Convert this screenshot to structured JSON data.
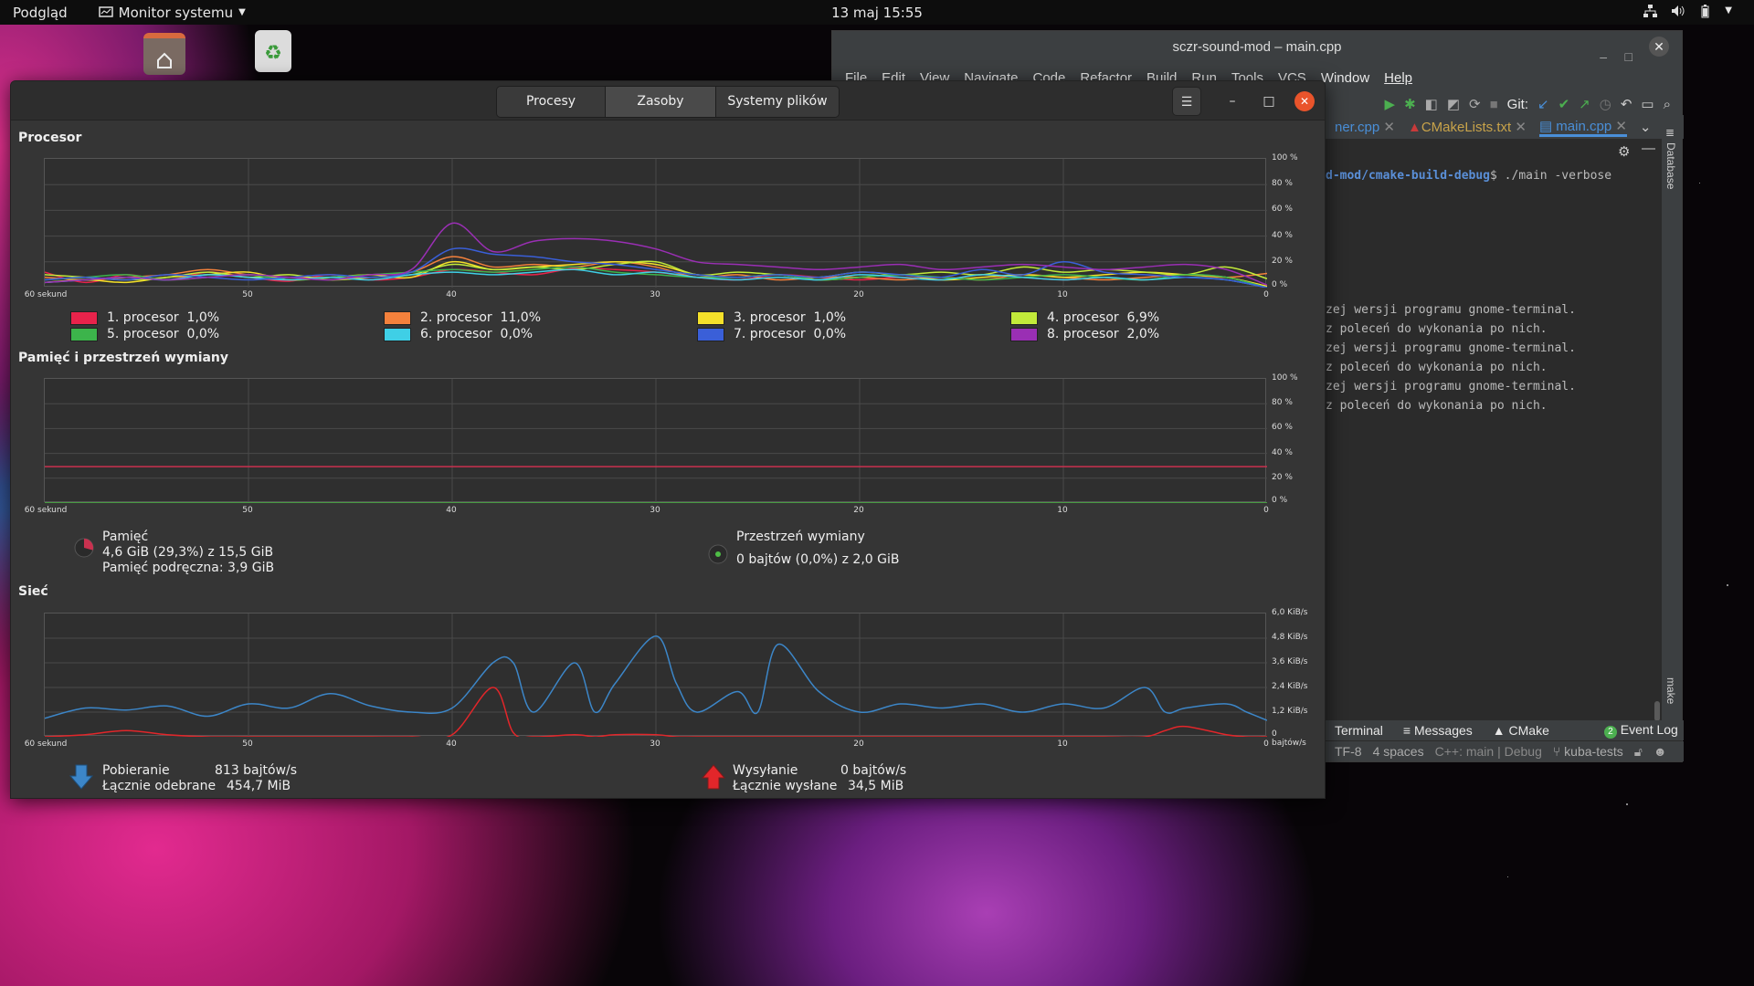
{
  "topbar": {
    "activities": "Podgląd",
    "app_menu": "Monitor systemu",
    "clock": "13 maj  15:55"
  },
  "ide": {
    "title": "sczr-sound-mod – main.cpp",
    "menu": [
      "File",
      "Edit",
      "View",
      "Navigate",
      "Code",
      "Refactor",
      "Build",
      "Run",
      "Tools",
      "VCS",
      "Window",
      "Help"
    ],
    "git_label": "Git:",
    "tabs": [
      "ner.cpp",
      "CMakeLists.txt",
      "main.cpp"
    ],
    "side_label": "Database",
    "side_label2": "make",
    "prompt_path": "d-mod/cmake-build-debug",
    "prompt_cmd": "$ ./main -verbose",
    "terminal_lines": [
      "zej wersji programu gnome-terminal.",
      "z poleceń do wykonania po nich.",
      "zej wersji programu gnome-terminal.",
      "z poleceń do wykonania po nich.",
      "zej wersji programu gnome-terminal.",
      "z poleceń do wykonania po nich."
    ],
    "bottom_tabs": [
      "Terminal",
      "Messages",
      "CMake",
      "Event Log"
    ],
    "event_count": "2",
    "status": [
      "TF-8",
      "4 spaces",
      "C++: main | Debug",
      "kuba-tests"
    ]
  },
  "monitor": {
    "tabs": [
      "Procesy",
      "Zasoby",
      "Systemy plików"
    ],
    "active_tab": "Zasoby",
    "cpu": {
      "title": "Procesor",
      "y_ticks": [
        "100 %",
        "80 %",
        "60 %",
        "40 %",
        "20 %",
        "0 %"
      ],
      "x_ticks": [
        "60 sekund",
        "50",
        "40",
        "30",
        "20",
        "10",
        "0"
      ],
      "legend": [
        {
          "label": "1. procesor",
          "value": "1,0%",
          "color": "#e8234b"
        },
        {
          "label": "2. procesor",
          "value": "11,0%",
          "color": "#f4813c"
        },
        {
          "label": "3. procesor",
          "value": "1,0%",
          "color": "#f4e02a"
        },
        {
          "label": "4. procesor",
          "value": "6,9%",
          "color": "#c2ea3a"
        },
        {
          "label": "5. procesor",
          "value": "0,0%",
          "color": "#3cb44b"
        },
        {
          "label": "6. procesor",
          "value": "0,0%",
          "color": "#3fcfe6"
        },
        {
          "label": "7. procesor",
          "value": "0,0%",
          "color": "#3a5fd8"
        },
        {
          "label": "8. procesor",
          "value": "2,0%",
          "color": "#9a2fb4"
        }
      ]
    },
    "memory": {
      "title": "Pamięć i przestrzeń wymiany",
      "y_ticks": [
        "100 %",
        "80 %",
        "60 %",
        "40 %",
        "20 %",
        "0 %"
      ],
      "x_ticks": [
        "60 sekund",
        "50",
        "40",
        "30",
        "20",
        "10",
        "0"
      ],
      "mem_label": "Pamięć",
      "mem_value": "4,6 GiB (29,3%) z 15,5 GiB",
      "mem_cache": "Pamięć podręczna: 3,9 GiB",
      "mem_color": "#c9314f",
      "mem_percent": 29.3,
      "swap_label": "Przestrzeń wymiany",
      "swap_value": "0 bajtów (0,0%) z 2,0 GiB",
      "swap_color": "#4ebd46",
      "swap_percent": 0.0
    },
    "network": {
      "title": "Sieć",
      "y_ticks": [
        "6,0 KiB/s",
        "4,8 KiB/s",
        "3,6 KiB/s",
        "2,4 KiB/s",
        "1,2 KiB/s",
        "0 bajtów/s"
      ],
      "x_ticks": [
        "60 sekund",
        "50",
        "40",
        "30",
        "20",
        "10",
        "0"
      ],
      "down_label": "Pobieranie",
      "down_rate": "813 bajtów/s",
      "down_total_label": "Łącznie odebrane",
      "down_total": "454,7 MiB",
      "down_color": "#3c86c8",
      "up_label": "Wysyłanie",
      "up_rate": "0 bajtów/s",
      "up_total_label": "Łącznie wysłane",
      "up_total": "34,5 MiB",
      "up_color": "#e2262a"
    }
  },
  "chart_data": [
    {
      "type": "line",
      "title": "Procesor",
      "x": [
        60,
        58,
        56,
        54,
        52,
        50,
        48,
        46,
        44,
        42,
        40,
        38,
        36,
        34,
        32,
        30,
        28,
        26,
        24,
        22,
        20,
        18,
        16,
        14,
        12,
        10,
        8,
        6,
        4,
        2,
        0
      ],
      "ylim": [
        0,
        100
      ],
      "series": [
        {
          "name": "1. procesor",
          "values": [
            12,
            4,
            10,
            6,
            12,
            8,
            5,
            10,
            6,
            8,
            14,
            12,
            10,
            15,
            14,
            12,
            8,
            6,
            10,
            8,
            6,
            8,
            6,
            10,
            8,
            6,
            8,
            6,
            10,
            8,
            1
          ]
        },
        {
          "name": "2. procesor",
          "values": [
            8,
            6,
            8,
            10,
            14,
            10,
            8,
            8,
            10,
            12,
            24,
            16,
            18,
            16,
            20,
            16,
            8,
            10,
            6,
            8,
            8,
            6,
            8,
            6,
            10,
            8,
            6,
            8,
            10,
            8,
            11
          ]
        },
        {
          "name": "3. procesor",
          "values": [
            4,
            6,
            4,
            8,
            10,
            12,
            6,
            8,
            10,
            8,
            20,
            14,
            16,
            18,
            20,
            18,
            10,
            8,
            10,
            6,
            8,
            10,
            6,
            8,
            10,
            8,
            10,
            12,
            10,
            8,
            1
          ]
        },
        {
          "name": "4. procesor",
          "values": [
            10,
            8,
            6,
            8,
            12,
            8,
            10,
            6,
            8,
            10,
            18,
            14,
            16,
            14,
            18,
            20,
            10,
            12,
            10,
            8,
            12,
            10,
            12,
            10,
            16,
            12,
            14,
            12,
            10,
            16,
            6.9
          ]
        },
        {
          "name": "5. procesor",
          "values": [
            6,
            8,
            10,
            6,
            8,
            10,
            6,
            8,
            10,
            12,
            14,
            12,
            14,
            16,
            12,
            10,
            8,
            8,
            10,
            6,
            8,
            10,
            8,
            6,
            8,
            10,
            8,
            6,
            10,
            8,
            0
          ]
        },
        {
          "name": "6. procesor",
          "values": [
            4,
            6,
            8,
            6,
            10,
            8,
            6,
            8,
            6,
            10,
            12,
            10,
            12,
            14,
            10,
            12,
            8,
            6,
            8,
            6,
            10,
            8,
            6,
            10,
            8,
            6,
            8,
            6,
            8,
            6,
            0
          ]
        },
        {
          "name": "7. procesor",
          "values": [
            6,
            8,
            6,
            10,
            8,
            6,
            8,
            10,
            8,
            12,
            30,
            26,
            24,
            20,
            18,
            14,
            10,
            8,
            10,
            8,
            12,
            10,
            8,
            14,
            10,
            20,
            12,
            10,
            8,
            6,
            0
          ]
        },
        {
          "name": "8. procesor",
          "values": [
            4,
            6,
            8,
            6,
            8,
            10,
            8,
            6,
            10,
            14,
            50,
            28,
            36,
            38,
            36,
            30,
            20,
            18,
            16,
            14,
            16,
            18,
            14,
            16,
            18,
            16,
            14,
            16,
            18,
            14,
            2
          ]
        }
      ]
    },
    {
      "type": "line",
      "title": "Pamięć i przestrzeń wymiany",
      "x": [
        60,
        0
      ],
      "ylim": [
        0,
        100
      ],
      "series": [
        {
          "name": "Pamięć",
          "values": [
            29.3,
            29.3
          ]
        },
        {
          "name": "Przestrzeń wymiany",
          "values": [
            0,
            0
          ]
        }
      ]
    },
    {
      "type": "line",
      "title": "Sieć",
      "x": [
        60,
        58,
        56,
        54,
        52,
        50,
        48,
        46,
        44,
        42,
        40,
        38,
        37,
        36,
        34,
        33,
        32,
        30,
        29,
        28,
        26,
        25,
        24,
        22,
        20,
        18,
        16,
        14,
        12,
        10,
        8,
        6,
        5,
        4,
        2,
        1,
        0
      ],
      "ylim": [
        0,
        6.0
      ],
      "yunit": "KiB/s",
      "series": [
        {
          "name": "Pobieranie",
          "values": [
            0.9,
            1.4,
            1.3,
            1.5,
            1.0,
            1.6,
            1.4,
            2.1,
            1.5,
            1.2,
            1.4,
            3.6,
            3.6,
            1.2,
            3.6,
            1.2,
            2.6,
            4.9,
            2.6,
            1.2,
            2.2,
            1.2,
            4.5,
            2.2,
            1.2,
            1.6,
            1.4,
            1.6,
            1.2,
            1.6,
            1.4,
            2.4,
            1.2,
            1.4,
            1.6,
            1.2,
            0.8
          ]
        },
        {
          "name": "Wysyłanie",
          "values": [
            0,
            0.1,
            0.3,
            0.1,
            0,
            0,
            0,
            0,
            0,
            0,
            0.1,
            2.4,
            0.2,
            0,
            0.1,
            0,
            0.1,
            0.1,
            0,
            0,
            0,
            0,
            0,
            0,
            0,
            0,
            0,
            0,
            0,
            0,
            0,
            0,
            0.3,
            0.5,
            0.1,
            0,
            0
          ]
        }
      ]
    }
  ]
}
